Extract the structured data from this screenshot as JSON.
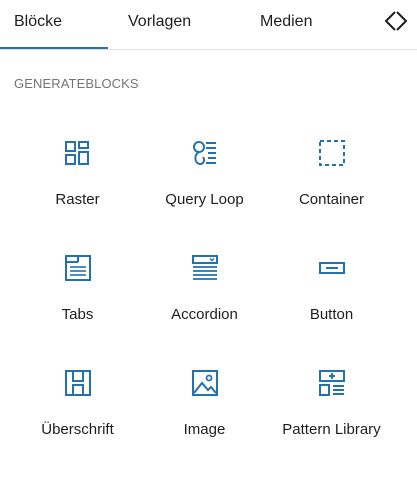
{
  "tabs": {
    "bloecke": "Blöcke",
    "vorlagen": "Vorlagen",
    "medien": "Medien"
  },
  "collapse_icon": "chevrons-collapse-icon",
  "section": {
    "heading": "GENERATEBLOCKS"
  },
  "blocks": [
    {
      "label": "Raster",
      "icon": "grid-icon"
    },
    {
      "label": "Query Loop",
      "icon": "query-loop-icon"
    },
    {
      "label": "Container",
      "icon": "container-icon"
    },
    {
      "label": "Tabs",
      "icon": "tabs-icon"
    },
    {
      "label": "Accordion",
      "icon": "accordion-icon"
    },
    {
      "label": "Button",
      "icon": "button-icon"
    },
    {
      "label": "Überschrift",
      "icon": "heading-icon"
    },
    {
      "label": "Image",
      "icon": "image-icon"
    },
    {
      "label": "Pattern Library",
      "icon": "pattern-library-icon"
    }
  ],
  "colors": {
    "accent": "#2271b1",
    "text": "#1e1e1e",
    "muted": "#757575",
    "icon": "#2271b1"
  }
}
